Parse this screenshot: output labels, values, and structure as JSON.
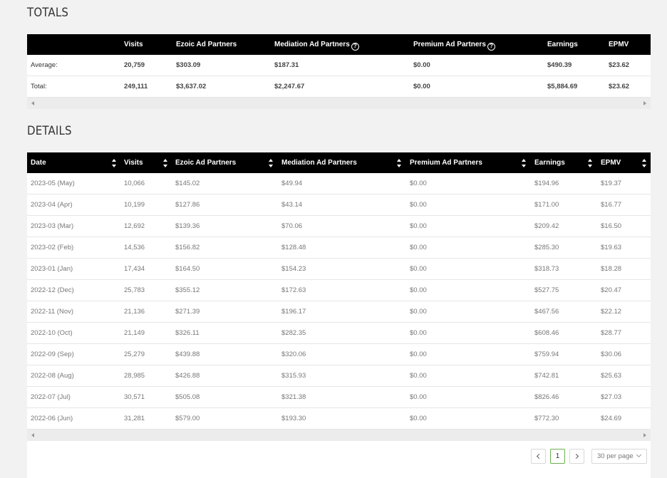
{
  "totals": {
    "title": "TOTALS",
    "columns": [
      "",
      "Visits",
      "Ezoic Ad Partners",
      "Mediation Ad Partners",
      "Premium Ad Partners",
      "Earnings",
      "EPMV"
    ],
    "rows": [
      [
        "Average:",
        "20,759",
        "$303.09",
        "$187.31",
        "$0.00",
        "$490.39",
        "$23.62"
      ],
      [
        "Total:",
        "249,111",
        "$3,637.02",
        "$2,247.67",
        "$0.00",
        "$5,884.69",
        "$23.62"
      ]
    ]
  },
  "details": {
    "title": "DETAILS",
    "columns": [
      "Date",
      "Visits",
      "Ezoic Ad Partners",
      "Mediation Ad Partners",
      "Premium Ad Partners",
      "Earnings",
      "EPMV"
    ],
    "rows": [
      [
        "2023-05 (May)",
        "10,066",
        "$145.02",
        "$49.94",
        "$0.00",
        "$194.96",
        "$19.37"
      ],
      [
        "2023-04 (Apr)",
        "10,199",
        "$127.86",
        "$43.14",
        "$0.00",
        "$171.00",
        "$16.77"
      ],
      [
        "2023-03 (Mar)",
        "12,692",
        "$139.36",
        "$70.06",
        "$0.00",
        "$209.42",
        "$16.50"
      ],
      [
        "2023-02 (Feb)",
        "14,536",
        "$156.82",
        "$128.48",
        "$0.00",
        "$285.30",
        "$19.63"
      ],
      [
        "2023-01 (Jan)",
        "17,434",
        "$164.50",
        "$154.23",
        "$0.00",
        "$318.73",
        "$18.28"
      ],
      [
        "2022-12 (Dec)",
        "25,783",
        "$355.12",
        "$172.63",
        "$0.00",
        "$527.75",
        "$20.47"
      ],
      [
        "2022-11 (Nov)",
        "21,136",
        "$271.39",
        "$196.17",
        "$0.00",
        "$467.56",
        "$22.12"
      ],
      [
        "2022-10 (Oct)",
        "21,149",
        "$326.11",
        "$282.35",
        "$0.00",
        "$608.46",
        "$28.77"
      ],
      [
        "2022-09 (Sep)",
        "25,279",
        "$439.88",
        "$320.06",
        "$0.00",
        "$759.94",
        "$30.06"
      ],
      [
        "2022-08 (Aug)",
        "28,985",
        "$426.88",
        "$315.93",
        "$0.00",
        "$742.81",
        "$25.63"
      ],
      [
        "2022-07 (Jul)",
        "30,571",
        "$505.08",
        "$321.38",
        "$0.00",
        "$826.46",
        "$27.03"
      ],
      [
        "2022-06 (Jun)",
        "31,281",
        "$579.00",
        "$193.30",
        "$0.00",
        "$772.30",
        "$24.69"
      ]
    ]
  },
  "pagination": {
    "current_page": "1",
    "per_page": "30 per page"
  },
  "icons": {
    "help": "help-circle-icon",
    "sort": "sort-icon",
    "prev": "chevron-left-icon",
    "next": "chevron-right-icon",
    "dropdown": "chevron-down-icon"
  }
}
